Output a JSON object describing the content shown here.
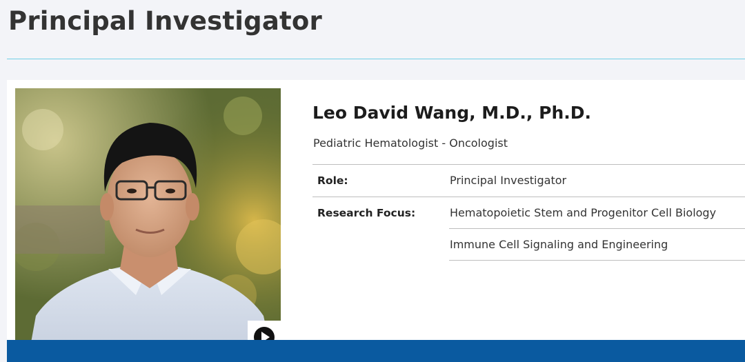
{
  "section": {
    "title": "Principal Investigator"
  },
  "profile": {
    "name": "Leo David Wang, M.D., Ph.D.",
    "subtitle": "Pediatric Hematologist - Oncologist",
    "photo_alt": "Leo David Wang, M.D., Ph.D.",
    "details": [
      {
        "label": "Role:",
        "value": "Principal Investigator"
      },
      {
        "label": "Research Focus:",
        "value": "Hematopoietic Stem and Progenitor Cell Biology"
      },
      {
        "label": "",
        "value": "Immune Cell Signaling and Engineering"
      }
    ],
    "video_button_icon": "play-icon"
  },
  "colors": {
    "accent_rule": "#6fcfe6",
    "band_blue": "#0a5aa0",
    "page_bg": "#f3f4f8"
  }
}
